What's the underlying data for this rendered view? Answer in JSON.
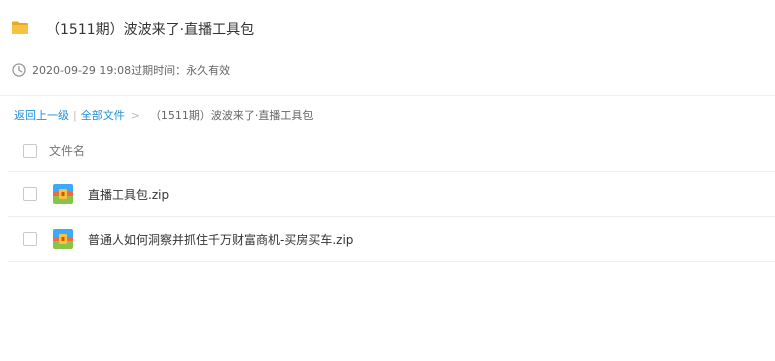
{
  "header": {
    "title": "（1511期）波波来了·直播工具包",
    "date": "2020-09-29 19:08",
    "expiry_label": "过期时间：",
    "expiry_value": "永久有效",
    "icons": {
      "folder": "folder-icon",
      "clock": "clock-icon"
    }
  },
  "breadcrumb": {
    "back": "返回上一级",
    "separator": "|",
    "all_files": "全部文件",
    "arrow": ">",
    "current": "（1511期）波波来了·直播工具包"
  },
  "list": {
    "column_header": "文件名",
    "files": [
      {
        "name": "直播工具包.zip",
        "icon": "zip-archive-icon"
      },
      {
        "name": "普通人如何洞察并抓住千万财富商机-买房买车.zip",
        "icon": "zip-archive-icon"
      }
    ]
  },
  "colors": {
    "link": "#1e8ed8",
    "folder": "#f5c242",
    "zip_top": "#3fa9f5",
    "zip_bottom": "#8bc34a",
    "zip_band": "#f06a3a"
  }
}
